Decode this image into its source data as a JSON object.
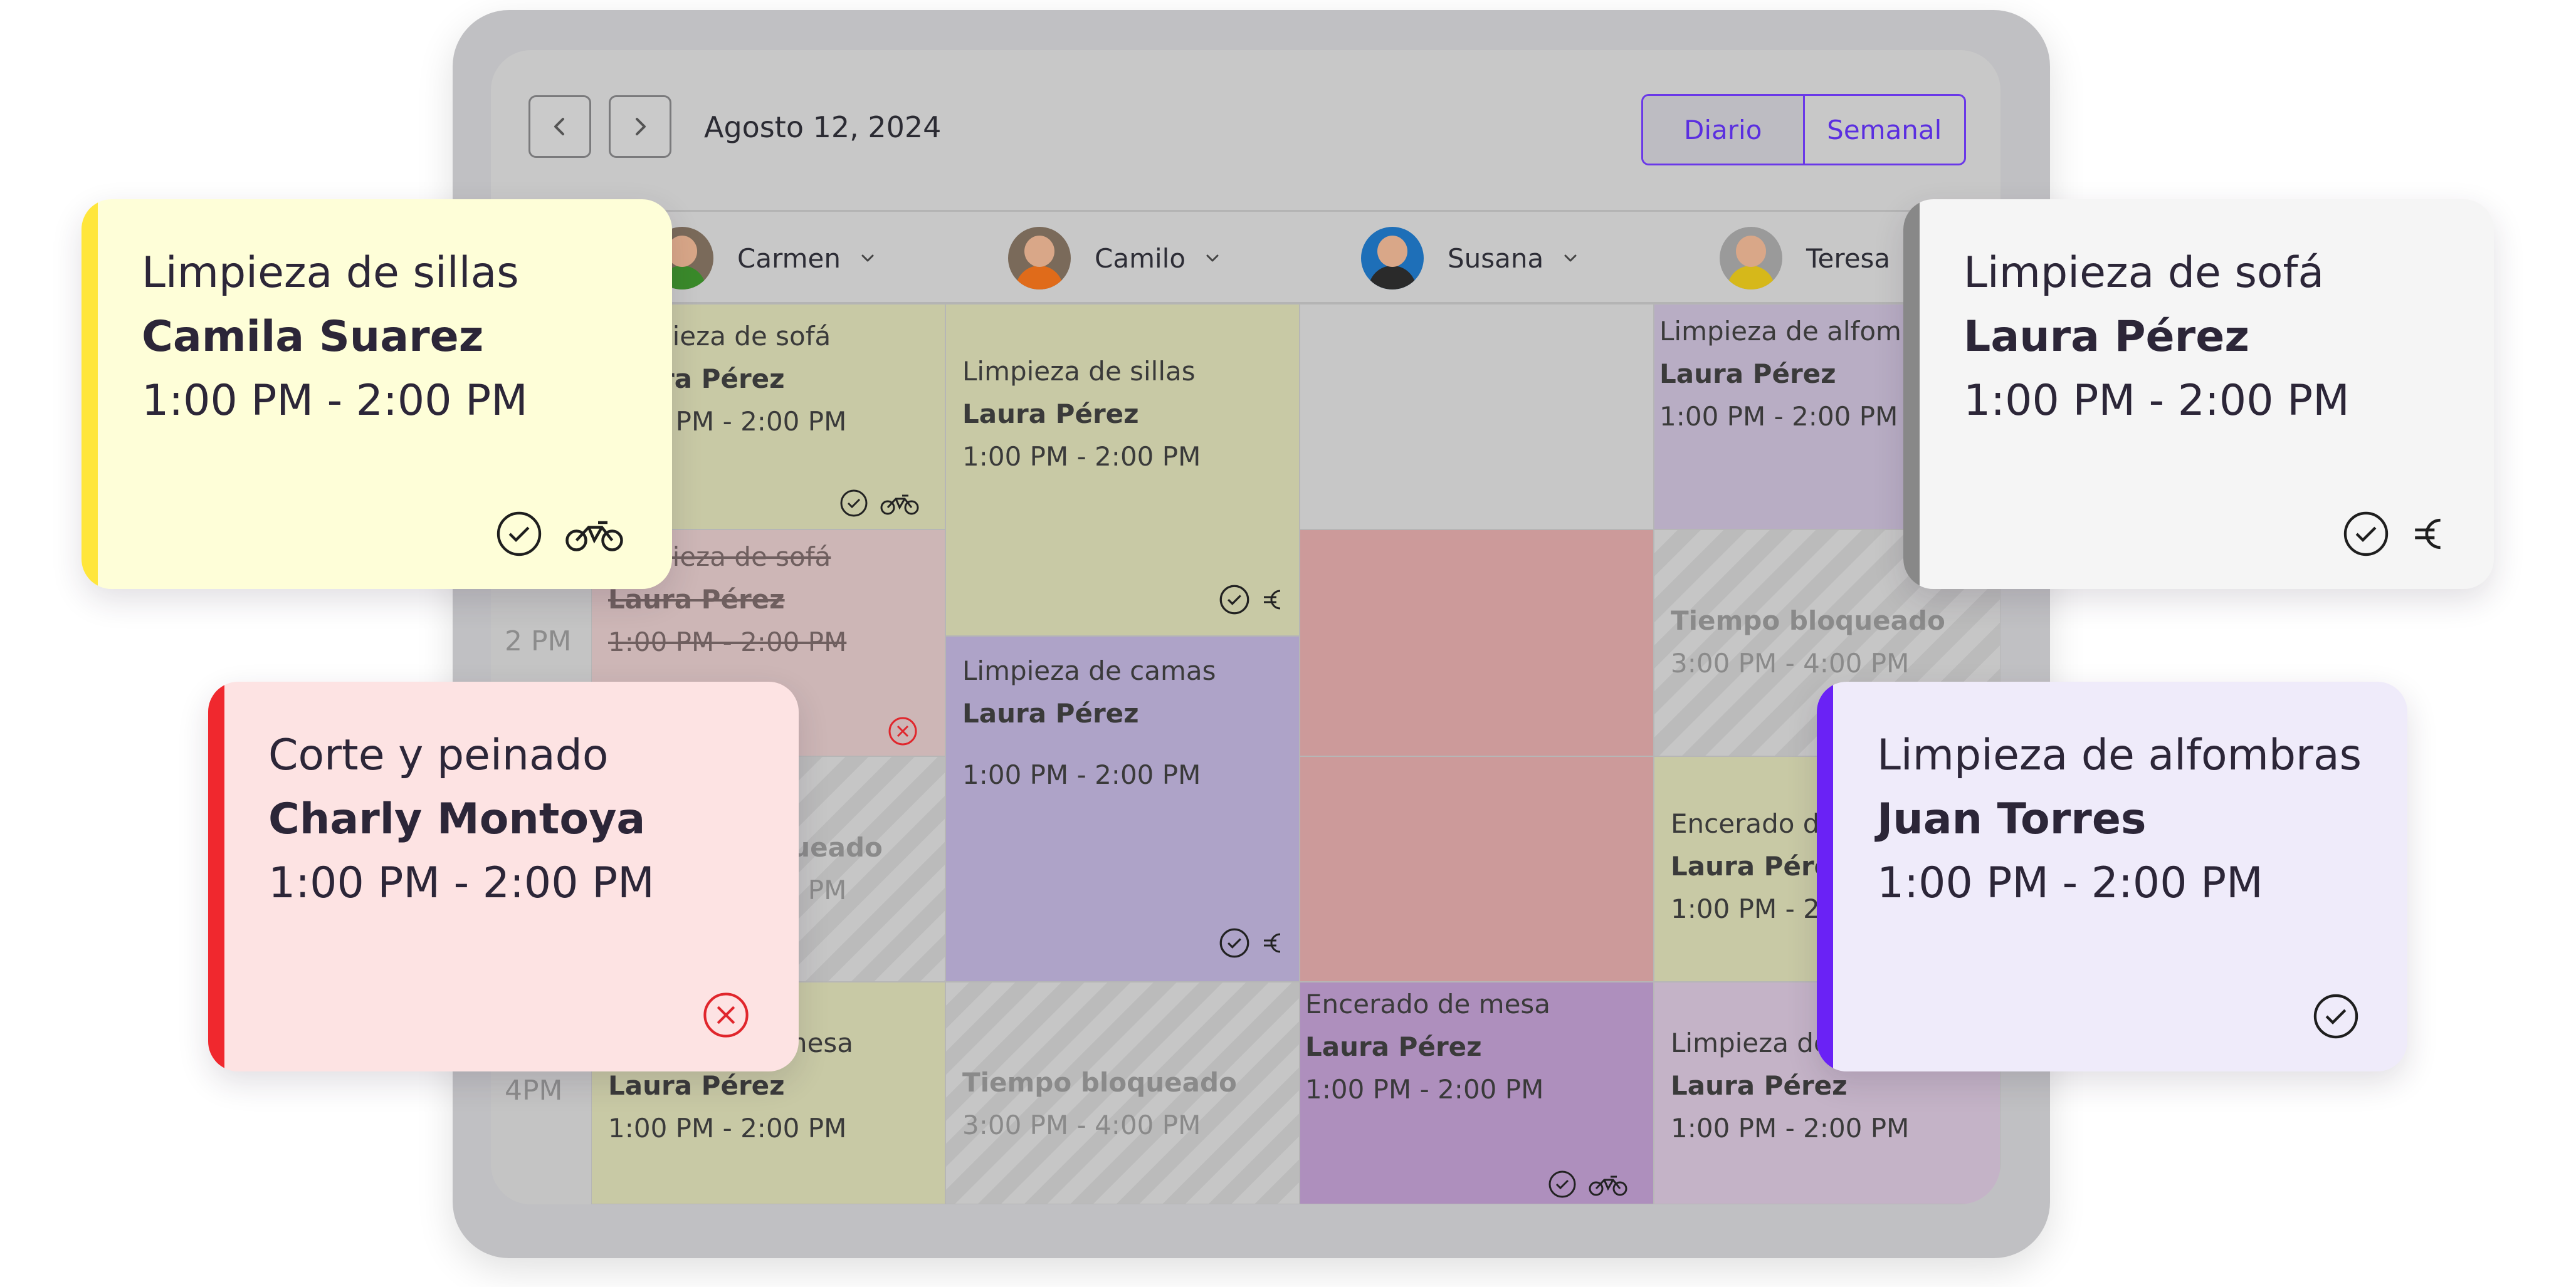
{
  "calendar": {
    "date": "Agosto 12,  2024",
    "views": {
      "daily": "Diario",
      "weekly": "Semanal"
    },
    "time_labels": {
      "two_pm": "2 PM",
      "four_pm": "4PM"
    },
    "staff": [
      {
        "name": "Carmen"
      },
      {
        "name": "Camilo"
      },
      {
        "name": "Susana"
      },
      {
        "name": "Teresa"
      }
    ],
    "cells": {
      "carmen_1": {
        "service": "Limpieza de sofá",
        "client": "Laura Pérez",
        "time": "1:00 PM - 2:00 PM"
      },
      "carmen_2": {
        "service": "Limpieza de sofá",
        "client": "Laura Pérez",
        "time": "1:00 PM - 2:00 PM"
      },
      "carmen_3": {
        "service": "Tiempo bloqueado",
        "time": "3:00 PM - 4:00 PM"
      },
      "carmen_4": {
        "service": "Encerado de mesa",
        "client": "Laura Pérez",
        "time": "1:00 PM - 2:00 PM"
      },
      "camilo_1": {
        "service": "Limpieza de sillas",
        "client": "Laura Pérez",
        "time": "1:00 PM - 2:00 PM"
      },
      "camilo_2": {
        "service": "Limpieza de camas",
        "client": "Laura Pérez",
        "time": "1:00 PM - 2:00 PM"
      },
      "camilo_3": {
        "service": "Tiempo bloqueado",
        "time": "3:00 PM - 4:00 PM"
      },
      "susana_4": {
        "service": "Encerado de mesa",
        "client": "Laura Pérez",
        "time": "1:00 PM - 2:00 PM"
      },
      "teresa_1": {
        "service": "Limpieza de alfombras",
        "client": "Laura Pérez",
        "time": "1:00 PM - 2:00 PM"
      },
      "teresa_2": {
        "service": "Tiempo bloqueado",
        "time": "3:00 PM - 4:00 PM"
      },
      "teresa_3": {
        "service": "Encerado de mesa",
        "client": "Laura Pérez",
        "time": "1:00 PM - 2:00 PM"
      },
      "teresa_4": {
        "service": "Limpieza de sofá",
        "client": "Laura Pérez",
        "time": "1:00 PM - 2:00 PM"
      }
    }
  },
  "cards": {
    "yellow": {
      "service": "Limpieza de sillas",
      "client": "Camila Suarez",
      "time": "1:00 PM - 2:00 PM",
      "accent": "#ffe63b",
      "background": "#fefed8"
    },
    "gray": {
      "service": "Limpieza de sofá",
      "client": "Laura Pérez",
      "time": "1:00 PM - 2:00 PM",
      "accent": "#888888",
      "background": "#f5f5f5"
    },
    "red": {
      "service": "Corte y peinado",
      "client": "Charly Montoya",
      "time": "1:00 PM - 2:00 PM",
      "accent": "#f0282e",
      "background": "#fde3e3"
    },
    "purple": {
      "service": "Limpieza de alfombras",
      "client": "Juan Torres",
      "time": "1:00 PM - 2:00 PM",
      "accent": "#6a22f5",
      "background": "#efebfa"
    }
  },
  "icons": [
    "chevron-left-icon",
    "chevron-right-icon",
    "chevron-down-icon",
    "check-circle-icon",
    "motorcycle-icon",
    "euro-icon",
    "cancel-circle-icon"
  ]
}
